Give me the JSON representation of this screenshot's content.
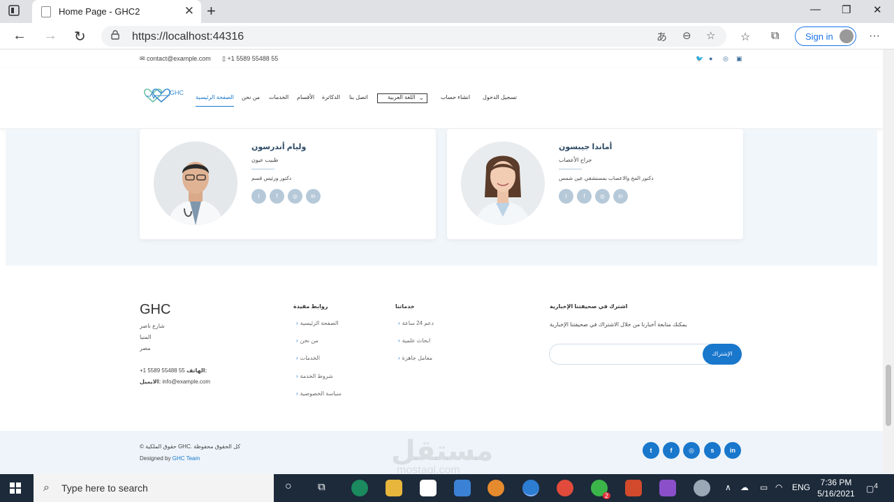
{
  "browser": {
    "tab_title": "Home Page - GHC2",
    "url": "https://localhost:44316",
    "sign_in": "Sign in"
  },
  "topbar": {
    "email": "contact@example.com",
    "phone": "+1 5589 55488 55"
  },
  "nav": {
    "logo_text": "GHC",
    "items": [
      "الصفحة الرئيسية",
      "من نحن",
      "الخدمات",
      "الأقسام",
      "الدكاترة",
      "اتصل بنا"
    ],
    "language": "اللغة العربية",
    "signup": "انشاء حساب",
    "login": "تسجيل الدخول"
  },
  "doctors": [
    {
      "name": "وليام أندرسون",
      "role": "طبيب عيون",
      "desc": "دكتور ورئيس قسم"
    },
    {
      "name": "أماندا جيبسون",
      "role": "جراح الأعصاب",
      "desc": "دكتور المخ والاعصاب بمستشفي عين شمس"
    }
  ],
  "footer": {
    "brand": "GHC",
    "address": [
      "شارع ناصر",
      "المنيا",
      "مصر"
    ],
    "phone_label": "الهاتف:",
    "phone": "+1 5589 55488 55",
    "email_label": "الايميل:",
    "email": "info@example.com",
    "links_title": "روابط مفيدة",
    "links": [
      "الصفحة الرئيسية",
      "من نحن",
      "الخدمات",
      "شروط الخدمة",
      "سياسة الخصوصية"
    ],
    "services_title": "خدماتنا",
    "services": [
      "دعم 24 ساعة",
      "ابحاث علمية",
      "معامل جاهزة"
    ],
    "newsletter_title": "اشترك في صحيفتنا الإخبارية",
    "newsletter_text": "يمكنك متابعة أخبارنا من خلال الاشتراك في صحيفتنا الإخبارية",
    "subscribe": "الإشتراك"
  },
  "bottom": {
    "copyright": "© حقوق الملكية GHC. كل الحقوق محفوظة",
    "designed_by": "Designed by",
    "team": "GHC Team",
    "watermark": "مستقل",
    "watermark_sub": "mostaql.com"
  },
  "taskbar": {
    "search_placeholder": "Type here to search",
    "lang": "ENG",
    "time": "7:36 PM",
    "date": "5/16/2021",
    "notifications": "4",
    "whatsapp_badge": "2"
  },
  "colors": {
    "accent": "#1977cc",
    "heading": "#2c4964",
    "social_muted": "#b6c9d9"
  }
}
